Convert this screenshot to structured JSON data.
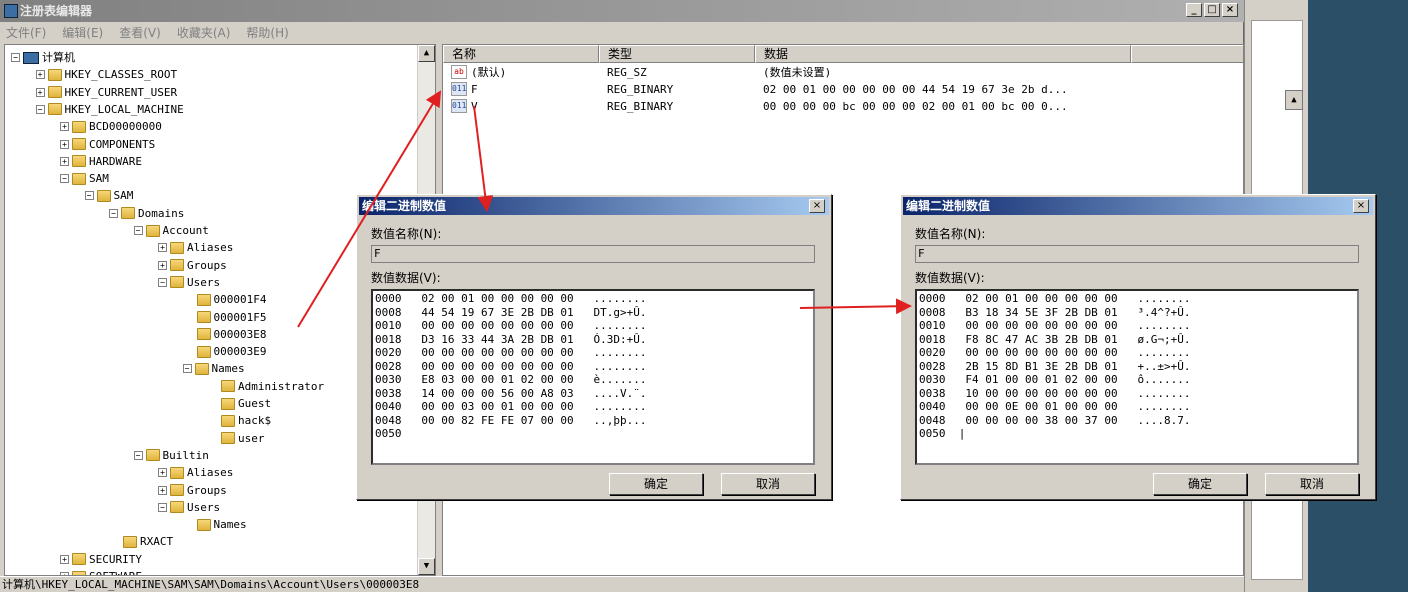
{
  "window": {
    "title": "注册表编辑器"
  },
  "menu": [
    "文件(F)",
    "编辑(E)",
    "查看(V)",
    "收藏夹(A)",
    "帮助(H)"
  ],
  "tree": [
    {
      "label": "计算机",
      "level": 0
    },
    {
      "label": "HKEY_CLASSES_ROOT",
      "level": 1
    },
    {
      "label": "HKEY_CURRENT_USER",
      "level": 1
    },
    {
      "label": "HKEY_LOCAL_MACHINE",
      "level": 1
    },
    {
      "label": "BCD00000000",
      "level": 2
    },
    {
      "label": "COMPONENTS",
      "level": 2
    },
    {
      "label": "HARDWARE",
      "level": 2
    },
    {
      "label": "SAM",
      "level": 2
    },
    {
      "label": "SAM",
      "level": 3
    },
    {
      "label": "Domains",
      "level": 4
    },
    {
      "label": "Account",
      "level": 5
    },
    {
      "label": "Aliases",
      "level": 6
    },
    {
      "label": "Groups",
      "level": 6
    },
    {
      "label": "Users",
      "level": 6
    },
    {
      "label": "000001F4",
      "level": 7
    },
    {
      "label": "000001F5",
      "level": 7
    },
    {
      "label": "000003E8",
      "level": 7
    },
    {
      "label": "000003E9",
      "level": 7
    },
    {
      "label": "Names",
      "level": 7
    },
    {
      "label": "Administrator",
      "level": 8
    },
    {
      "label": "Guest",
      "level": 8
    },
    {
      "label": "hack$",
      "level": 8
    },
    {
      "label": "user",
      "level": 8
    },
    {
      "label": "Builtin",
      "level": 5
    },
    {
      "label": "Aliases",
      "level": 6
    },
    {
      "label": "Groups",
      "level": 6
    },
    {
      "label": "Users",
      "level": 6
    },
    {
      "label": "Names",
      "level": 7
    },
    {
      "label": "RXACT",
      "level": 4
    },
    {
      "label": "SECURITY",
      "level": 2
    },
    {
      "label": "SOFTWARE",
      "level": 2
    }
  ],
  "list": {
    "columns": [
      "名称",
      "类型",
      "数据"
    ],
    "rows": [
      {
        "icon": "ab",
        "name": "(默认)",
        "type": "REG_SZ",
        "data": "(数值未设置)"
      },
      {
        "icon": "bin",
        "name": "F",
        "type": "REG_BINARY",
        "data": "02 00 01 00 00 00 00 00 44 54 19 67 3e 2b d..."
      },
      {
        "icon": "bin",
        "name": "V",
        "type": "REG_BINARY",
        "data": "00 00 00 00 bc 00 00 00 02 00 01 00 bc 00 0..."
      }
    ]
  },
  "status": "计算机\\HKEY_LOCAL_MACHINE\\SAM\\SAM\\Domains\\Account\\Users\\000003E8",
  "dialogs": [
    {
      "title": "编辑二进制数值",
      "name_label": "数值名称(N):",
      "name_value": "F",
      "data_label": "数值数据(V):",
      "ok": "确定",
      "cancel": "取消",
      "hex": [
        "0000   02 00 01 00 00 00 00 00   ........",
        "0008   44 54 19 67 3E 2B DB 01   DT.g>+Û.",
        "0010   00 00 00 00 00 00 00 00   ........",
        "0018   D3 16 33 44 3A 2B DB 01   Ó.3D:+Û.",
        "0020   00 00 00 00 00 00 00 00   ........",
        "0028   00 00 00 00 00 00 00 00   ........",
        "0030   E8 03 00 00 01 02 00 00   è.......",
        "0038   14 00 00 00 56 00 A8 03   ....V.¨.",
        "0040   00 00 03 00 01 00 00 00   ........",
        "0048   00 00 82 FE FE 07 00 00   ..‚þþ...",
        "0050"
      ]
    },
    {
      "title": "编辑二进制数值",
      "name_label": "数值名称(N):",
      "name_value": "F",
      "data_label": "数值数据(V):",
      "ok": "确定",
      "cancel": "取消",
      "hex": [
        "0000   02 00 01 00 00 00 00 00   ........",
        "0008   B3 18 34 5E 3F 2B DB 01   ³.4^?+Û.",
        "0010   00 00 00 00 00 00 00 00   ........",
        "0018   F8 8C 47 AC 3B 2B DB 01   ø.G¬;+Û.",
        "0020   00 00 00 00 00 00 00 00   ........",
        "0028   2B 15 8D B1 3E 2B DB 01   +..±>+Û.",
        "0030   F4 01 00 00 01 02 00 00   ô.......",
        "0038   10 00 00 00 00 00 00 00   ........",
        "0040   00 00 0E 00 01 00 00 00   ........",
        "0048   00 00 00 00 38 00 37 00   ....8.7.",
        "0050  |"
      ]
    }
  ]
}
